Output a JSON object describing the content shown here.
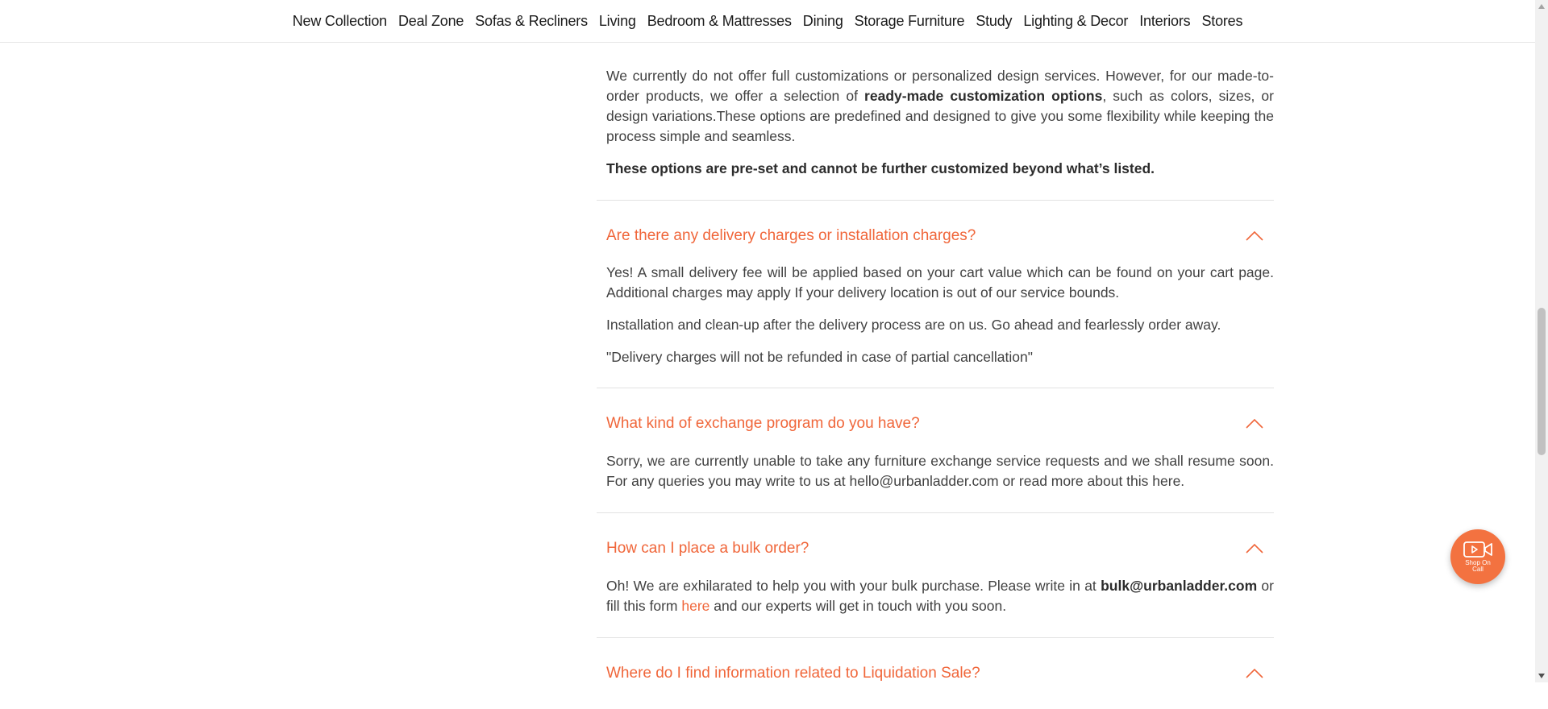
{
  "nav": {
    "items": [
      "New Collection",
      "Deal Zone",
      "Sofas & Recliners",
      "Living",
      "Bedroom & Mattresses",
      "Dining",
      "Storage Furniture",
      "Study",
      "Lighting & Decor",
      "Interiors",
      "Stores"
    ]
  },
  "faq": {
    "customization": {
      "p1_a": "We currently do not offer full customizations or personalized design services. However, for our made-to-order products, we offer a selection of ",
      "p1_b": "ready-made customization options",
      "p1_c": ", such as colors, sizes, or design variations.These options are predefined and designed to give you some flexibility while keeping the process simple and seamless.",
      "p2": "These options are pre-set and cannot be further customized beyond what’s listed."
    },
    "delivery": {
      "question": "Are there any delivery charges or installation charges?",
      "p1": "Yes! A small delivery fee will be applied based on your cart value which can be found on your cart page. Additional charges may apply If your delivery location is out of our service bounds.",
      "p2": "Installation and clean-up after the delivery process are on us. Go ahead and fearlessly order away.",
      "p3": "\"Delivery charges will not be refunded in case of partial cancellation\""
    },
    "exchange": {
      "question": "What kind of exchange program do you have?",
      "p1": "Sorry, we are currently unable to take any furniture exchange service requests and we shall resume soon. For any queries you may write to us at hello@urbanladder.com or read more about this here."
    },
    "bulk": {
      "question": "How can I place a bulk order?",
      "p1_a": "Oh! We are exhilarated to help you with your bulk purchase. Please write in at ",
      "email": "bulk@urbanladder.com",
      "p1_b": " or fill this form ",
      "link": "here",
      "p1_c": " and our experts will get in touch with you soon."
    },
    "liquidation": {
      "question": "Where do I find information related to Liquidation Sale?"
    }
  },
  "shop_on_call": {
    "label": "Shop On Call",
    "icon": "video-camera-icon"
  },
  "colors": {
    "accent": "#f0663a",
    "button": "#f37240",
    "text": "#414141"
  }
}
